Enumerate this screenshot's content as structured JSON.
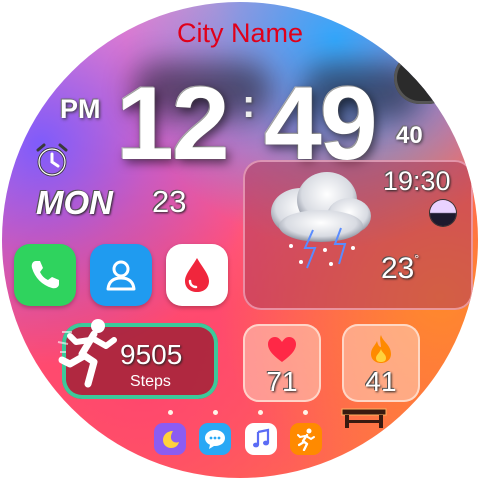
{
  "header": {
    "city": "City Name"
  },
  "clock": {
    "hours": "12",
    "colon": ":",
    "minutes": "49",
    "ampm": "PM",
    "seconds": "40"
  },
  "date": {
    "day": "MON",
    "date": "23"
  },
  "weather": {
    "time": "19:30",
    "temperature": "23",
    "degree_symbol": "°",
    "condition_icon": "thunderstorm-cloud-icon"
  },
  "apps": [
    {
      "name": "phone",
      "color": "#2fd35e"
    },
    {
      "name": "contacts",
      "color": "#1f9bf0"
    },
    {
      "name": "blood-oxygen",
      "color": "#ffffff"
    }
  ],
  "steps": {
    "value": "9505",
    "label": "Steps"
  },
  "heart_rate": {
    "value": "71"
  },
  "calories": {
    "value": "41"
  },
  "dock": [
    {
      "name": "sleep",
      "color": "#8c5cf2"
    },
    {
      "name": "messages",
      "color": "#29a8f5"
    },
    {
      "name": "music",
      "color": "#ffffff"
    },
    {
      "name": "exercise",
      "color": "#ff8a00"
    }
  ],
  "colors": {
    "city": "#e0001a",
    "steps_ring": "#3cc99a"
  }
}
